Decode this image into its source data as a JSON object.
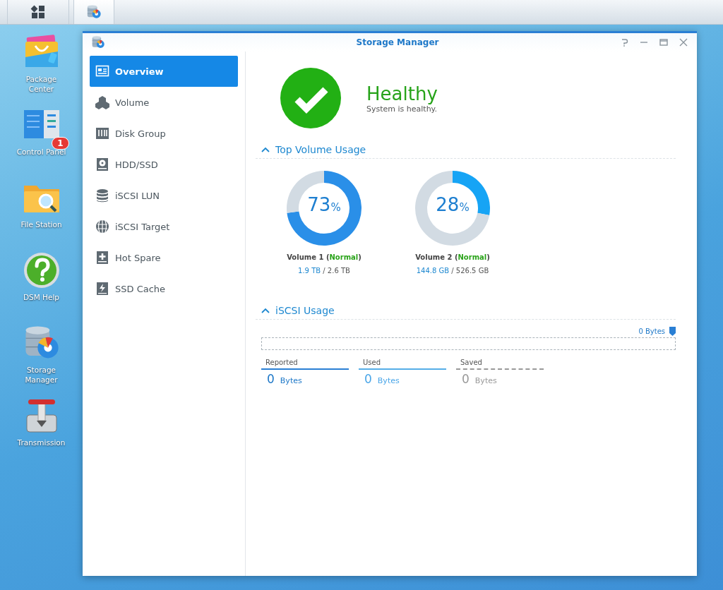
{
  "taskbar": {
    "buttons": [
      {
        "kind": "grid",
        "selected": false
      },
      {
        "kind": "storage",
        "selected": true
      }
    ]
  },
  "desktop": {
    "icons": [
      {
        "kind": "package",
        "label": "Package Center"
      },
      {
        "kind": "control",
        "label": "Control Panel",
        "badge": "1"
      },
      {
        "kind": "folder",
        "label": "File Station"
      },
      {
        "kind": "help",
        "label": "DSM Help"
      },
      {
        "kind": "storage",
        "label": "Storage Manager"
      },
      {
        "kind": "transmission",
        "label": "Transmission"
      }
    ]
  },
  "window": {
    "title": "Storage Manager"
  },
  "sidebar": {
    "items": [
      {
        "kind": "overview",
        "label": "Overview",
        "selected": true
      },
      {
        "kind": "volume",
        "label": "Volume",
        "selected": false
      },
      {
        "kind": "diskgroup",
        "label": "Disk Group",
        "selected": false
      },
      {
        "kind": "hdd",
        "label": "HDD/SSD",
        "selected": false
      },
      {
        "kind": "lun",
        "label": "iSCSI LUN",
        "selected": false
      },
      {
        "kind": "target",
        "label": "iSCSI Target",
        "selected": false
      },
      {
        "kind": "spare",
        "label": "Hot Spare",
        "selected": false
      },
      {
        "kind": "cache",
        "label": "SSD Cache",
        "selected": false
      }
    ]
  },
  "status": {
    "title": "Healthy",
    "message": "System is healthy."
  },
  "top_volume_usage": {
    "heading": "Top Volume Usage",
    "expanded": true,
    "volumes": [
      {
        "percent": "73",
        "unit": "%",
        "chart_data": {
          "type": "donut",
          "values": [
            73,
            27
          ]
        },
        "title_prefix": "Volume 1 (",
        "status": "Normal",
        "title_suffix": ")",
        "used": "1.9 TB",
        "total": "/ 2.6 TB"
      },
      {
        "percent": "28",
        "unit": "%",
        "chart_data": {
          "type": "donut",
          "values": [
            28,
            72
          ]
        },
        "title_prefix": "Volume 2 (",
        "status": "Normal",
        "title_suffix": ")",
        "used": "144.8 GB",
        "total": "/ 526.5 GB"
      }
    ]
  },
  "iscsi_usage": {
    "heading": "iSCSI Usage",
    "expanded": true,
    "marker_label": "0 Bytes",
    "metrics": [
      {
        "kind": "reported",
        "label": "Reported",
        "value": "0",
        "unit": "Bytes"
      },
      {
        "kind": "used",
        "label": "Used",
        "value": "0",
        "unit": "Bytes"
      },
      {
        "kind": "saved",
        "label": "Saved",
        "value": "0",
        "unit": "Bytes"
      }
    ]
  }
}
